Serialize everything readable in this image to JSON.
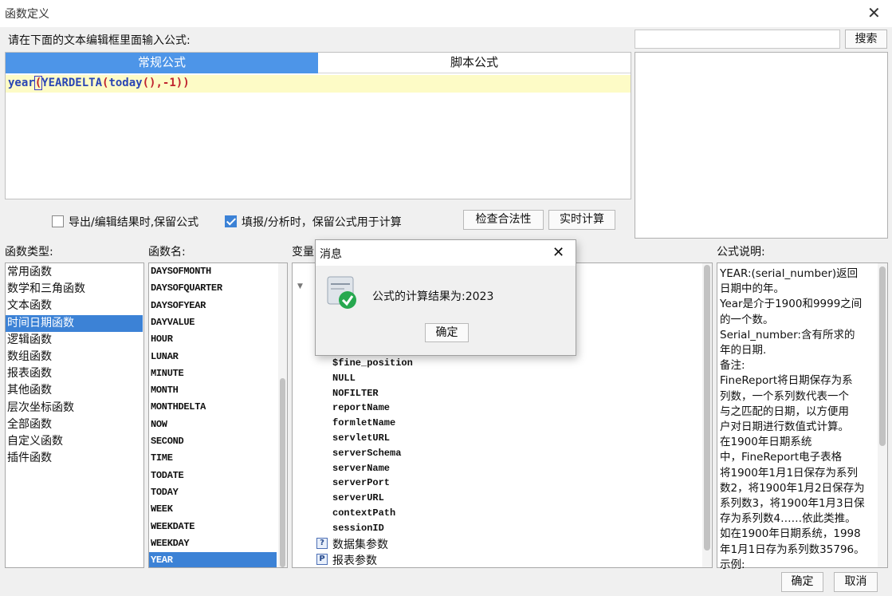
{
  "window": {
    "title": "函数定义",
    "close_symbol": "✕"
  },
  "editor": {
    "prompt": "请在下面的文本编辑框里面输入公式:",
    "tabs": [
      {
        "label": "常规公式",
        "active": true
      },
      {
        "label": "脚本公式",
        "active": false
      }
    ],
    "formula_parts": {
      "fn1": "year",
      "p1": "(",
      "fn2": "YEARDELTA",
      "p2": "(",
      "fn3": "today",
      "p3": "()",
      "arg": ",-1",
      "p4": "))"
    }
  },
  "search": {
    "value": "",
    "button_label": "搜索"
  },
  "options": {
    "export_keep": {
      "label": "导出/编辑结果时,保留公式",
      "checked": false
    },
    "fill_keep": {
      "label": "填报/分析时，保留公式用于计算",
      "checked": true
    },
    "check_button": "检查合法性",
    "realtime_button": "实时计算"
  },
  "sections": {
    "types_label": "函数类型:",
    "names_label": "函数名:",
    "vars_label": "变量",
    "doc_label": "公式说明:"
  },
  "function_types": [
    {
      "label": "常用函数",
      "selected": false
    },
    {
      "label": "数学和三角函数",
      "selected": false
    },
    {
      "label": "文本函数",
      "selected": false
    },
    {
      "label": "时间日期函数",
      "selected": true
    },
    {
      "label": "逻辑函数",
      "selected": false
    },
    {
      "label": "数组函数",
      "selected": false
    },
    {
      "label": "报表函数",
      "selected": false
    },
    {
      "label": "其他函数",
      "selected": false
    },
    {
      "label": "层次坐标函数",
      "selected": false
    },
    {
      "label": "全部函数",
      "selected": false
    },
    {
      "label": "自定义函数",
      "selected": false
    },
    {
      "label": "插件函数",
      "selected": false
    }
  ],
  "function_names": [
    {
      "label": "DAYSOFMONTH",
      "selected": false
    },
    {
      "label": "DAYSOFQUARTER",
      "selected": false
    },
    {
      "label": "DAYSOFYEAR",
      "selected": false
    },
    {
      "label": "DAYVALUE",
      "selected": false
    },
    {
      "label": "HOUR",
      "selected": false
    },
    {
      "label": "LUNAR",
      "selected": false
    },
    {
      "label": "MINUTE",
      "selected": false
    },
    {
      "label": "MONTH",
      "selected": false
    },
    {
      "label": "MONTHDELTA",
      "selected": false
    },
    {
      "label": "NOW",
      "selected": false
    },
    {
      "label": "SECOND",
      "selected": false
    },
    {
      "label": "TIME",
      "selected": false
    },
    {
      "label": "TODATE",
      "selected": false
    },
    {
      "label": "TODAY",
      "selected": false
    },
    {
      "label": "WEEK",
      "selected": false
    },
    {
      "label": "WEEKDATE",
      "selected": false
    },
    {
      "label": "WEEKDAY",
      "selected": false
    },
    {
      "label": "YEAR",
      "selected": true
    }
  ],
  "variables": [
    "$fine_position",
    "NULL",
    "NOFILTER",
    "reportName",
    "formletName",
    "servletURL",
    "serverSchema",
    "serverName",
    "serverPort",
    "serverURL",
    "contextPath",
    "sessionID"
  ],
  "variable_groups": [
    {
      "label": "数据集参数",
      "icon": "dataset-param-icon",
      "glyph": "?"
    },
    {
      "label": "报表参数",
      "icon": "report-param-icon",
      "glyph": "P"
    }
  ],
  "doc_lines": [
    "YEAR:(serial_number)返回",
    "日期中的年。",
    "Year是介于1900和9999之间",
    "的一个数。",
    "Serial_number:含有所求的",
    "年的日期.",
    "备注:",
    "FineReport将日期保存为系",
    "列数，一个系列数代表一个",
    "与之匹配的日期，以方便用",
    "户对日期进行数值式计算。",
    "在1900年日期系统",
    "中，FineReport电子表格",
    "将1900年1月1日保存为系列",
    "数2，将1900年1月2日保存为",
    "系列数3，将1900年1月3日保",
    "存为系列数4……依此类推。",
    "如在1900年日期系统，1998",
    "年1月1日存为系列数35796。",
    "示例:"
  ],
  "dialog": {
    "title": "消息",
    "close_symbol": "✕",
    "message": "公式的计算结果为:2023",
    "ok_label": "确定",
    "icon": "success-check-icon"
  },
  "footer": {
    "ok_label": "确定",
    "cancel_label": "取消"
  }
}
